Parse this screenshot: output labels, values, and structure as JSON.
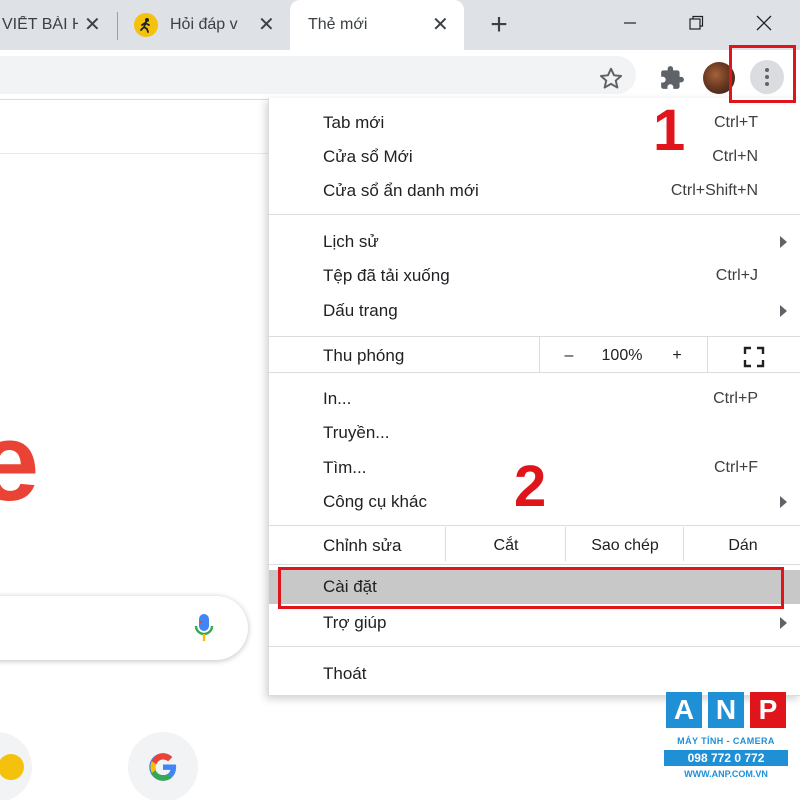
{
  "tabs": [
    {
      "title": "VIẾT BÀI H",
      "close": "✕"
    },
    {
      "title": "Hỏi đáp v",
      "close": "✕"
    },
    {
      "title": "Thẻ mới",
      "close": "✕"
    }
  ],
  "newtab": "+",
  "window": {
    "minimize": "—",
    "maximize": "❐",
    "close": "✕"
  },
  "page": {
    "logo_fragment": "e"
  },
  "menu": {
    "items": [
      {
        "label": "Tab mới",
        "shortcut": "Ctrl+T"
      },
      {
        "label": "Cửa sổ Mới",
        "shortcut": "Ctrl+N"
      },
      {
        "label": "Cửa sổ ẩn danh mới",
        "shortcut": "Ctrl+Shift+N"
      },
      {
        "label": "Lịch sử",
        "shortcut": ""
      },
      {
        "label": "Tệp đã tải xuống",
        "shortcut": "Ctrl+J"
      },
      {
        "label": "Dấu trang",
        "shortcut": ""
      },
      {
        "label": "In...",
        "shortcut": "Ctrl+P"
      },
      {
        "label": "Truyền...",
        "shortcut": ""
      },
      {
        "label": "Tìm...",
        "shortcut": "Ctrl+F"
      },
      {
        "label": "Công cụ khác",
        "shortcut": ""
      },
      {
        "label": "Cài đặt",
        "shortcut": ""
      },
      {
        "label": "Trợ giúp",
        "shortcut": ""
      },
      {
        "label": "Thoát",
        "shortcut": ""
      }
    ],
    "zoom": {
      "label": "Thu phóng",
      "minus": "–",
      "value": "100%",
      "plus": "+"
    },
    "edit": {
      "label": "Chỉnh sửa",
      "cut": "Cắt",
      "copy": "Sao chép",
      "paste": "Dán"
    }
  },
  "annotations": {
    "step1": "1",
    "step2": "2"
  },
  "watermark": {
    "letters": [
      "A",
      "N",
      "P"
    ],
    "tagline": "MÁY TÍNH - CAMERA",
    "phone": "098 772 0 772",
    "website": "WWW.ANP.COM.VN"
  },
  "colors": {
    "annotation_red": "#e0151b",
    "google_red": "#ea4335",
    "highlight": "#c8c8c8",
    "brand_blue": "#1f8fd6"
  }
}
